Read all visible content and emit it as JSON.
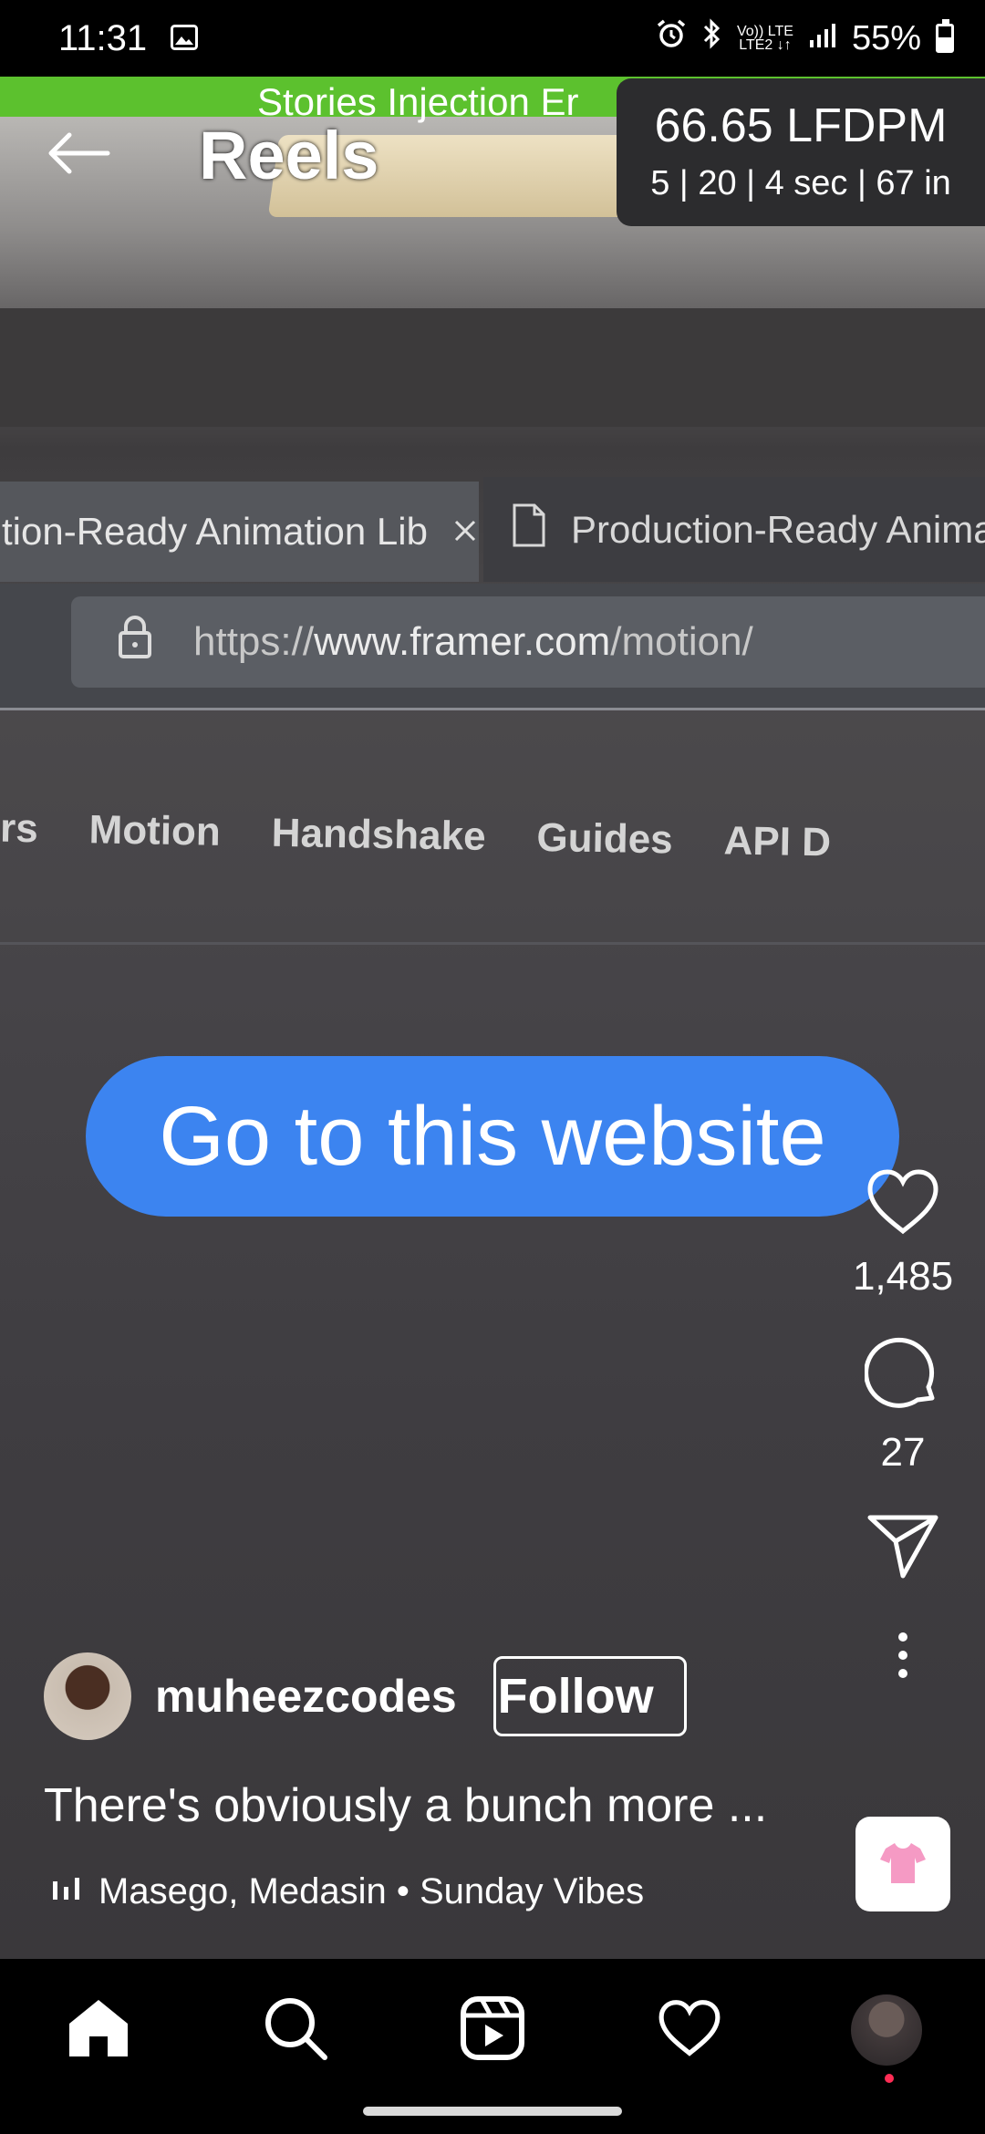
{
  "status_bar": {
    "time": "11:31",
    "network_top": "Vo)) LTE",
    "network_bottom": "LTE2 ↓↑",
    "battery": "55%"
  },
  "debug": {
    "green_bar_text": "Stories Injection Er",
    "lfdpm": "66.65 LFDPM",
    "stats": "5 | 20 | 4 sec | 67 in"
  },
  "header": {
    "title": "Reels"
  },
  "video": {
    "tab1_title": "tion-Ready Animation Lib",
    "tab2_title": "Production-Ready Anima",
    "url_prefix": "https://",
    "url_domain": "www.framer.com",
    "url_path": "/motion/",
    "nav_items": [
      "rs",
      "Motion",
      "Handshake",
      "Guides",
      "API D"
    ],
    "cta": "Go to this website"
  },
  "actions": {
    "likes": "1,485",
    "comments": "27"
  },
  "post": {
    "username": "muheezcodes",
    "follow_label": "Follow",
    "caption": "There's obviously a bunch more ...",
    "audio": "Masego, Medasin • Sunday Vibes"
  },
  "icons": {
    "back": "arrow-left-icon",
    "like": "heart-icon",
    "comment": "comment-icon",
    "share": "send-icon",
    "more": "more-vertical-icon",
    "home": "home-icon",
    "search": "search-icon",
    "reels": "reels-icon",
    "activity": "heart-icon"
  }
}
